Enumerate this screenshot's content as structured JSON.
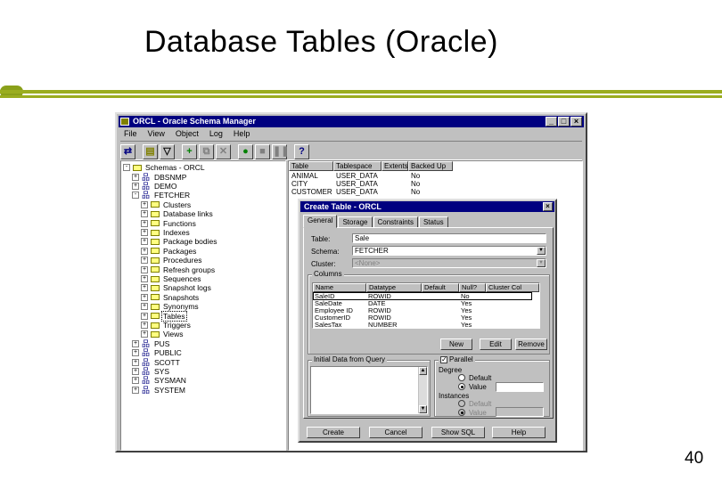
{
  "slide": {
    "title": "Database Tables (Oracle)",
    "page_number": "40"
  },
  "window": {
    "title": "ORCL - Oracle Schema Manager",
    "menu": [
      "File",
      "View",
      "Object",
      "Log",
      "Help"
    ],
    "controls": {
      "minimize": "_",
      "maximize": "□",
      "close": "×"
    }
  },
  "tree": {
    "items": [
      {
        "label": "Schemas - ORCL",
        "type": "folder",
        "level": 0,
        "exp": "-"
      },
      {
        "label": "DBSNMP",
        "type": "db",
        "level": 1,
        "exp": "+"
      },
      {
        "label": "DEMO",
        "type": "db",
        "level": 1,
        "exp": "+"
      },
      {
        "label": "FETCHER",
        "type": "db",
        "level": 1,
        "exp": "-"
      },
      {
        "label": "Clusters",
        "type": "folder",
        "level": 2,
        "exp": "+"
      },
      {
        "label": "Database links",
        "type": "folder",
        "level": 2,
        "exp": "+"
      },
      {
        "label": "Functions",
        "type": "folder",
        "level": 2,
        "exp": "+"
      },
      {
        "label": "Indexes",
        "type": "folder",
        "level": 2,
        "exp": "+"
      },
      {
        "label": "Package bodies",
        "type": "folder",
        "level": 2,
        "exp": "+"
      },
      {
        "label": "Packages",
        "type": "folder",
        "level": 2,
        "exp": "+"
      },
      {
        "label": "Procedures",
        "type": "folder",
        "level": 2,
        "exp": "+"
      },
      {
        "label": "Refresh groups",
        "type": "folder",
        "level": 2,
        "exp": "+"
      },
      {
        "label": "Sequences",
        "type": "folder",
        "level": 2,
        "exp": "+"
      },
      {
        "label": "Snapshot logs",
        "type": "folder",
        "level": 2,
        "exp": "+"
      },
      {
        "label": "Snapshots",
        "type": "folder",
        "level": 2,
        "exp": "+"
      },
      {
        "label": "Synonyms",
        "type": "folder",
        "level": 2,
        "exp": "+"
      },
      {
        "label": "Tables",
        "type": "folder",
        "level": 2,
        "exp": "+",
        "selected": true
      },
      {
        "label": "Triggers",
        "type": "folder",
        "level": 2,
        "exp": "+"
      },
      {
        "label": "Views",
        "type": "folder",
        "level": 2,
        "exp": "+"
      },
      {
        "label": "PUS",
        "type": "db",
        "level": 1,
        "exp": "+"
      },
      {
        "label": "PUBLIC",
        "type": "db",
        "level": 1,
        "exp": "+"
      },
      {
        "label": "SCOTT",
        "type": "db",
        "level": 1,
        "exp": "+"
      },
      {
        "label": "SYS",
        "type": "db",
        "level": 1,
        "exp": "+"
      },
      {
        "label": "SYSMAN",
        "type": "db",
        "level": 1,
        "exp": "+"
      },
      {
        "label": "SYSTEM",
        "type": "db",
        "level": 1,
        "exp": "+"
      }
    ]
  },
  "table_list": {
    "columns": [
      "Table",
      "Tablespace",
      "Extents",
      "Backed Up"
    ],
    "rows": [
      [
        "ANIMAL",
        "USER_DATA",
        "",
        "No"
      ],
      [
        "CITY",
        "USER_DATA",
        "",
        "No"
      ],
      [
        "CUSTOMER",
        "USER_DATA",
        "",
        "No"
      ]
    ]
  },
  "dialog": {
    "title": "Create Table - ORCL",
    "tabs": [
      "General",
      "Storage",
      "Constraints",
      "Status"
    ],
    "table_label": "Table:",
    "table_value": "Sale",
    "schema_label": "Schema:",
    "schema_value": "FETCHER",
    "cluster_label": "Cluster:",
    "cluster_value": "<None>",
    "columns_group": "Columns",
    "grid_headers": [
      "Name",
      "Datatype",
      "Default",
      "Null?",
      "Cluster Col"
    ],
    "grid_rows": [
      [
        "SaleID",
        "ROWID",
        "",
        "No",
        ""
      ],
      [
        "SaleDate",
        "DATE",
        "",
        "Yes",
        ""
      ],
      [
        "Employee ID",
        "ROWID",
        "",
        "Yes",
        ""
      ],
      [
        "CustomerID",
        "ROWID",
        "",
        "Yes",
        ""
      ],
      [
        "SalesTax",
        "NUMBER",
        "",
        "Yes",
        ""
      ]
    ],
    "btn_new": "New",
    "btn_edit": "Edit",
    "btn_remove": "Remove",
    "initial_group": "Initial Data from Query",
    "parallel_label": "Parallel",
    "parallel_check": "✓",
    "degree_label": "Degree",
    "radio_default": "Default",
    "radio_value": "Value",
    "instances_label": "Instances",
    "radio_default2": "Default",
    "radio_value2": "Value",
    "btn_create": "Create",
    "btn_cancel": "Cancel",
    "btn_showsql": "Show SQL",
    "btn_help": "Help",
    "close": "×"
  },
  "colors": {
    "accent_rule": "#9aad1f",
    "titlebar": "#000080",
    "face": "#c0c0c0"
  }
}
